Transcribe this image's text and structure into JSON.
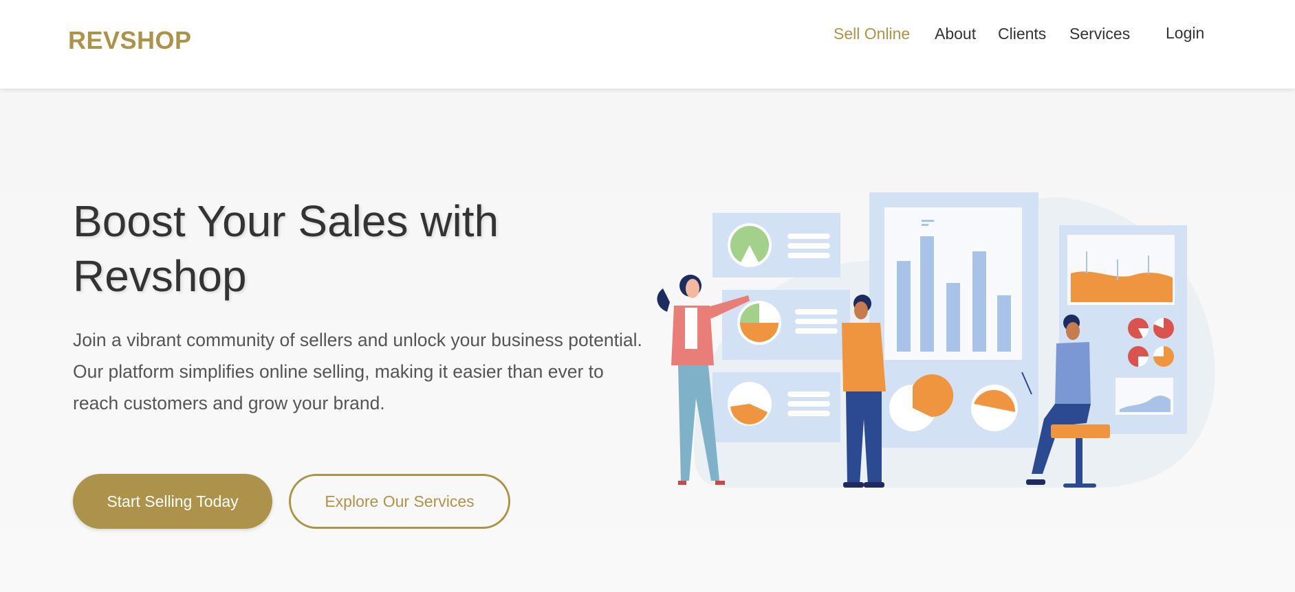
{
  "brand": {
    "name": "REVSHOP"
  },
  "nav": {
    "items": [
      {
        "label": "Sell Online",
        "active": true
      },
      {
        "label": "About",
        "active": false
      },
      {
        "label": "Clients",
        "active": false
      },
      {
        "label": "Services",
        "active": false
      },
      {
        "label": "Login",
        "active": false
      }
    ]
  },
  "hero": {
    "title_line1": "Boost Your Sales with",
    "title_line2": "Revshop",
    "description": "Join a vibrant community of sellers and unlock your business potential. Our platform simplifies online selling, making it easier than ever to reach customers and grow your brand.",
    "primary_button": "Start Selling Today",
    "secondary_button": "Explore Our Services"
  },
  "colors": {
    "accent": "#ad934a",
    "text_dark": "#333333",
    "text_body": "#555555",
    "illustration_blue": "#d3e1f5",
    "illustration_orange": "#f0953f"
  }
}
